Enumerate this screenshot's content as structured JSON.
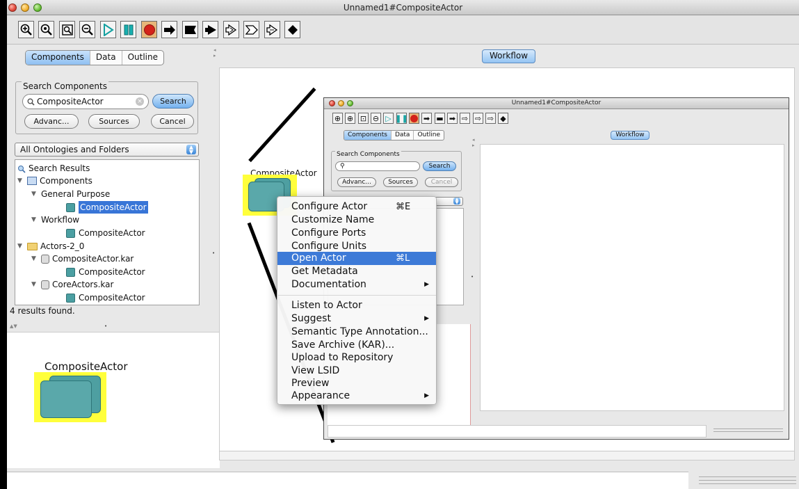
{
  "window": {
    "title": "Unnamed1#CompositeActor"
  },
  "icons": {
    "toolbar": [
      "zoom-in-icon",
      "zoom-reset-icon",
      "zoom-fit-icon",
      "zoom-out-icon",
      "run-icon",
      "pause-icon",
      "stop-icon",
      "arrow-right-icon",
      "flag-icon",
      "arrow-left-icon",
      "hollow-arrow-icon",
      "hollow-arrow-2-icon",
      "hollow-arrow-3-icon",
      "diamond-icon"
    ]
  },
  "colors": {
    "selection": "#3875d7",
    "menu_highlight": "#3d7ad7",
    "actor_fill": "#4e9fa1",
    "actor_highlight": "#ffff3b",
    "stop_red": "#d3231b"
  },
  "left": {
    "tabs": [
      "Components",
      "Data",
      "Outline"
    ],
    "search": {
      "title": "Search Components",
      "value": "CompositeActor",
      "search_button": "Search",
      "advanced_button": "Advanc...",
      "sources_button": "Sources",
      "cancel_button": "Cancel"
    },
    "ontology_select": "All Ontologies and Folders",
    "tree": {
      "search_results": "Search Results",
      "components": "Components",
      "general_purpose": "General Purpose",
      "composite_actor_1": "CompositeActor",
      "workflow": "Workflow",
      "composite_actor_2": "CompositeActor",
      "actors_folder": "Actors-2_0",
      "kar_1": "CompositeActor.kar",
      "composite_actor_3": "CompositeActor",
      "kar_2": "CoreActors.kar",
      "composite_actor_4": "CompositeActor"
    },
    "results_count": "4 results found.",
    "preview_label": "CompositeActor"
  },
  "workflow": {
    "tab": "Workflow",
    "actor_label": "CompositeActor"
  },
  "inner": {
    "title": "Unnamed1#CompositeActor",
    "tabs": [
      "Components",
      "Data",
      "Outline"
    ],
    "search_title": "Search Components",
    "search_button": "Search",
    "advanced_button": "Advanc...",
    "sources_button": "Sources",
    "cancel_button": "Cancel",
    "workflow_tab": "Workflow"
  },
  "menu": {
    "items": [
      {
        "label": "Configure Actor",
        "shortcut": "⌘E"
      },
      {
        "label": "Customize Name"
      },
      {
        "label": "Configure Ports"
      },
      {
        "label": "Configure Units"
      },
      {
        "label": "Open Actor",
        "shortcut": "⌘L"
      },
      {
        "label": "Get Metadata"
      },
      {
        "label": "Documentation"
      },
      {
        "label": "Listen to Actor"
      },
      {
        "label": "Suggest"
      },
      {
        "label": "Semantic Type Annotation..."
      },
      {
        "label": "Save Archive (KAR)..."
      },
      {
        "label": "Upload to Repository"
      },
      {
        "label": "View LSID"
      },
      {
        "label": "Preview"
      },
      {
        "label": "Appearance"
      }
    ]
  }
}
